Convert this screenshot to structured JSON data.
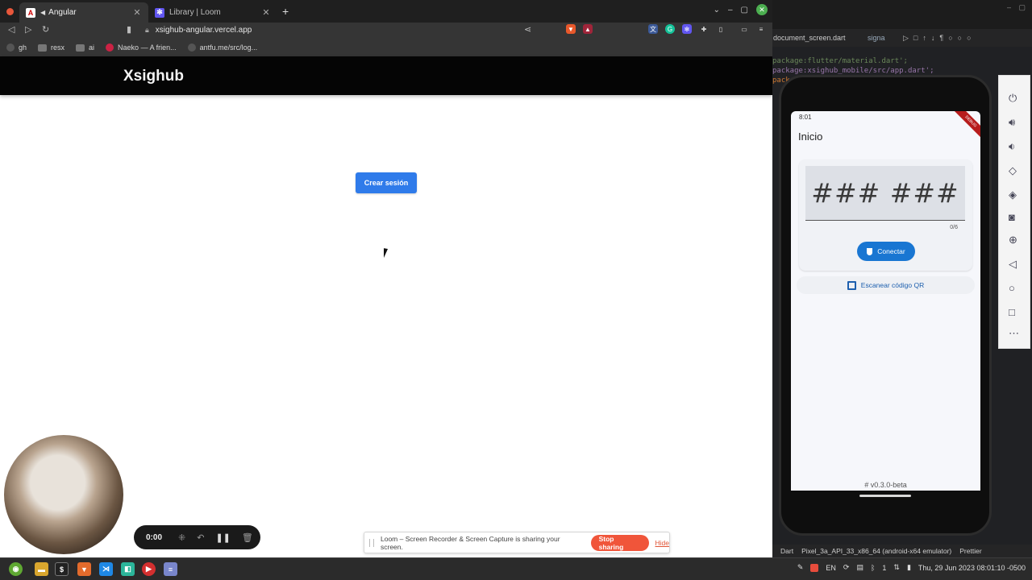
{
  "browser": {
    "tabs": [
      {
        "label": "Angular",
        "favicon": "A"
      },
      {
        "label": "Library | Loom"
      }
    ],
    "address": "xsighub-angular.vercel.app",
    "bookmarks": [
      "gh",
      "resx",
      "ai",
      "Naeko — A frien...",
      "antfu.me/src/log..."
    ]
  },
  "page": {
    "title": "Xsighub",
    "create_button": "Crear sesión"
  },
  "loom": {
    "timer": "0:00",
    "banner_text": "Loom – Screen Recorder & Screen Capture is sharing your screen.",
    "stop_label": "Stop sharing",
    "hide_label": "Hide"
  },
  "ide": {
    "tabs": [
      "document_screen.dart",
      "signa"
    ],
    "code_lines": [
      "package:flutter/material.dart';",
      "package:xsighub_mobile/src/app.dart';",
      "pack"
    ],
    "status_items": [
      "Dart",
      "Pixel_3a_API_33_x86_64 (android-x64 emulator)",
      "Prettier"
    ]
  },
  "phone": {
    "time": "8:01",
    "debug_label": "DEBUG",
    "title": "Inicio",
    "code_placeholder": "### ###",
    "counter": "0/6",
    "connect_label": "Conectar",
    "qr_label": "Escanear código QR",
    "version": "# v0.3.0-beta"
  },
  "taskbar": {
    "lang": "EN",
    "volume": "1",
    "datetime": "Thu, 29 Jun 2023 08:01:10 -0500"
  },
  "colors": {
    "primary_button": "#2f7bea",
    "loom_stop": "#f0553a",
    "phone_primary": "#1976d2"
  }
}
